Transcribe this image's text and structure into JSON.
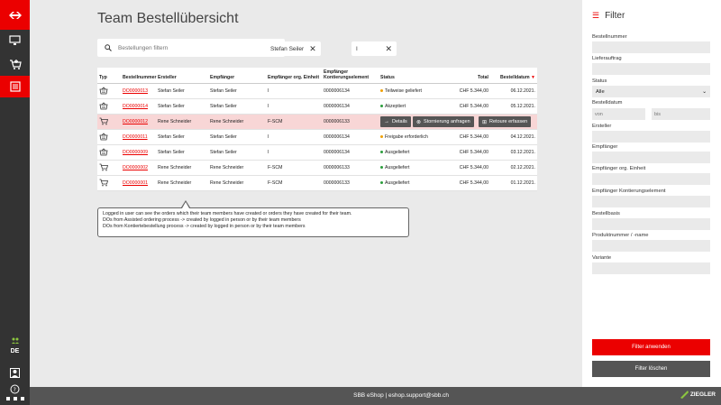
{
  "page": {
    "title": "Team Bestellübersicht"
  },
  "search": {
    "placeholder": "Bestellungen filtern"
  },
  "chips": [
    {
      "label": "Stefan Seiler"
    },
    {
      "label": "I"
    }
  ],
  "table": {
    "headers": {
      "typ": "Typ",
      "nr": "Bestellnummer",
      "ersteller": "Ersteller",
      "empf": "Empfänger",
      "einheit": "Empfänger org. Einheit",
      "kont_1": "Empfänger",
      "kont_2": "Kontierungselement",
      "status": "Status",
      "total": "Total",
      "datum": "Bestelldatum"
    },
    "rows": [
      {
        "icon": "basket-icon",
        "nr": "DO0000013",
        "ersteller": "Stefan Seiler",
        "empf": "Stefan Seiler",
        "einheit": "I",
        "kont": "0000006134",
        "status": "Teilweise geliefert",
        "total": "CHF 5.344,00",
        "datum": "06.12.2021."
      },
      {
        "icon": "basket-icon",
        "nr": "DO0000014",
        "ersteller": "Stefan Seiler",
        "empf": "Stefan Seiler",
        "einheit": "I",
        "kont": "0000006134",
        "status": "Akzeptiert",
        "total": "CHF 5.344,00",
        "datum": "05.12.2021."
      },
      {
        "icon": "cart-icon",
        "nr": "DO0000012",
        "ersteller": "Rene Schneider",
        "empf": "Rene Schneider",
        "einheit": "F-SCM",
        "kont": "0000006133",
        "status": "",
        "total": "",
        "datum": ""
      },
      {
        "icon": "basket-icon",
        "nr": "DO0000011",
        "ersteller": "Stefan Seiler",
        "empf": "Stefan Seiler",
        "einheit": "I",
        "kont": "0000006134",
        "status": "Freigabe erforderlich",
        "total": "CHF 5.344,00",
        "datum": "04.12.2021."
      },
      {
        "icon": "basket-icon",
        "nr": "DO0000009",
        "ersteller": "Stefan Seiler",
        "empf": "Stefan Seiler",
        "einheit": "I",
        "kont": "0000006134",
        "status": "Ausgeliefert",
        "total": "CHF 5.344,00",
        "datum": "03.12.2021."
      },
      {
        "icon": "cart-icon",
        "nr": "DO0000002",
        "ersteller": "Rene Schneider",
        "empf": "Rene Schneider",
        "einheit": "F-SCM",
        "kont": "0000006133",
        "status": "Ausgeliefert",
        "total": "CHF 5.344,00",
        "datum": "02.12.2021."
      },
      {
        "icon": "cart-icon",
        "nr": "DO0000001",
        "ersteller": "Rene Schneider",
        "empf": "Rene Schneider",
        "einheit": "F-SCM",
        "kont": "0000006133",
        "status": "Ausgeliefert",
        "total": "CHF 5.344,00",
        "datum": "01.12.2021."
      }
    ],
    "actions": {
      "details": "Details",
      "storno": "Stornierung anfragen",
      "retoure": "Retoure erfassen"
    }
  },
  "tooltip": {
    "line1": "Logged in user can see the orders which their team members have created or orders they have created for their team.",
    "line2": "DOs from Assisted ordering process -> created by logged in person or by their team members",
    "line3": "DOs from Kontiertebestellung process -> created by logged in person or by their team members"
  },
  "footer": {
    "text": "SBB eShop | eshop.support@sbb.ch",
    "brand": "ZIEGLER"
  },
  "rail": {
    "lang": "DE"
  },
  "filter": {
    "title": "Filter",
    "bestellnummer": "Bestellnummer",
    "lieferauftrag": "Lieferauftrag",
    "status": "Status",
    "status_value": "Alle",
    "bestelldatum": "Bestelldatum",
    "von": "von",
    "bis": "bis",
    "ersteller": "Ersteller",
    "empfaenger": "Empfänger",
    "einheit": "Empfänger org. Einheit",
    "kontierung": "Empfänger Kontierungselement",
    "bestellbasis": "Bestellbasis",
    "produkt": "Produktnummer / -name",
    "variante": "Variante",
    "apply": "Filter anwenden",
    "clear": "Filter löschen"
  },
  "colors": {
    "accent": "#eb0000",
    "dark": "#333333"
  }
}
